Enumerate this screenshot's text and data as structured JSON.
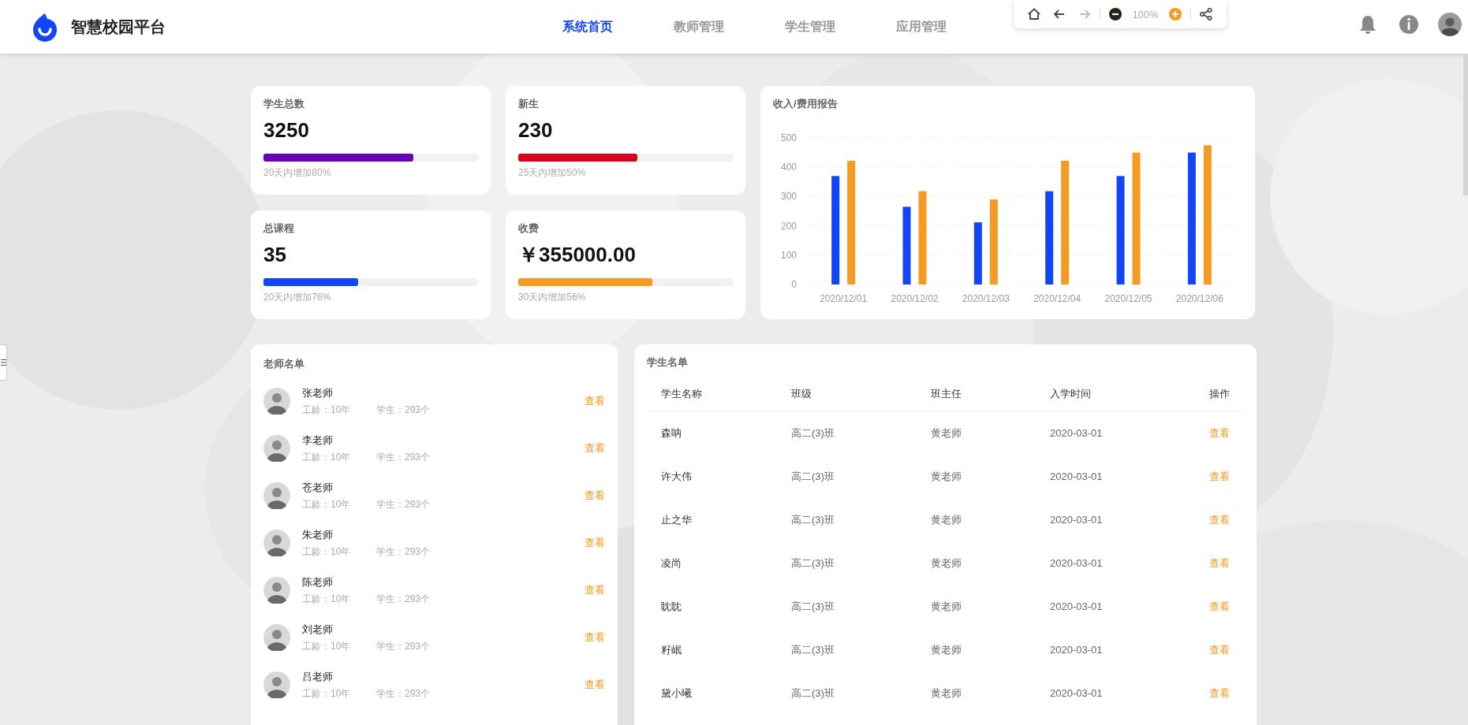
{
  "header": {
    "title": "智慧校园平台",
    "nav": [
      {
        "label": "系统首页",
        "selected": true
      },
      {
        "label": "教师管理",
        "selected": false
      },
      {
        "label": "学生管理",
        "selected": false
      },
      {
        "label": "应用管理",
        "selected": false
      }
    ],
    "toolbar": {
      "groups": [
        [
          {
            "kind": "home",
            "disabled": false
          },
          {
            "kind": "back",
            "disabled": false
          },
          {
            "kind": "forward",
            "disabled": true
          }
        ],
        [
          {
            "kind": "zoom-out",
            "disabled": false
          },
          {
            "kind": "zoom-level",
            "text": "100%"
          },
          {
            "kind": "zoom-in",
            "disabled": false
          }
        ],
        [
          {
            "kind": "share",
            "disabled": false
          }
        ]
      ]
    }
  },
  "stats": [
    {
      "label": "学生总数",
      "value": "3250",
      "level": 0.7,
      "color": "#6a00b8",
      "note": "20天内增加80%"
    },
    {
      "label": "新生",
      "value": "230",
      "level": 0.555,
      "color": "#d9001b",
      "note": "25天内增加50%"
    },
    {
      "label": "总课程",
      "value": "35",
      "level": 0.44,
      "color": "#1245f5",
      "note": "20天内增加76%"
    },
    {
      "label": "收费",
      "value": "￥355000.00",
      "level": 0.625,
      "color": "#f59a23",
      "note": "30天内增加56%"
    }
  ],
  "report": {
    "title": "收入/费用报告",
    "chart_data": {
      "type": "bar",
      "categories": [
        "2020/12/01",
        "2020/12/02",
        "2020/12/03",
        "2020/12/04",
        "2020/12/05",
        "2020/12/06"
      ],
      "series": [
        {
          "color": "#1245f5",
          "values": [
            370,
            265,
            212,
            318,
            370,
            450
          ]
        },
        {
          "color": "#f59a23",
          "values": [
            422,
            318,
            290,
            422,
            450,
            475
          ]
        }
      ],
      "grid": true,
      "ylim": [
        0,
        500
      ],
      "yticks": [
        0,
        100,
        200,
        300,
        400,
        500
      ]
    }
  },
  "teachers": {
    "title": "老师名单",
    "items": [
      {
        "name": "张老师",
        "experience": "工龄：10年",
        "students": "学生：293个",
        "action": "查看"
      },
      {
        "name": "李老师",
        "experience": "工龄：10年",
        "students": "学生：293个",
        "action": "查看"
      },
      {
        "name": "苍老师",
        "experience": "工龄：10年",
        "students": "学生：293个",
        "action": "查看"
      },
      {
        "name": "朱老师",
        "experience": "工龄：10年",
        "students": "学生：293个",
        "action": "查看"
      },
      {
        "name": "陈老师",
        "experience": "工龄：10年",
        "students": "学生：293个",
        "action": "查看"
      },
      {
        "name": "刘老师",
        "experience": "工龄：10年",
        "students": "学生：293个",
        "action": "查看"
      },
      {
        "name": "吕老师",
        "experience": "工龄：10年",
        "students": "学生：293个",
        "action": "查看"
      }
    ]
  },
  "students": {
    "title": "学生名单",
    "columns": [
      "学生名称",
      "班级",
      "班主任",
      "入学时间",
      "操作"
    ],
    "rows": [
      [
        "森呐",
        "高二(3)班",
        "黄老师",
        "2020-03-01",
        "查看"
      ],
      [
        "许大伟",
        "高二(3)班",
        "黄老师",
        "2020-03-01",
        "查看"
      ],
      [
        "止之华",
        "高二(3)班",
        "黄老师",
        "2020-03-01",
        "查看"
      ],
      [
        "凌尚",
        "高二(3)班",
        "黄老师",
        "2020-03-01",
        "查看"
      ],
      [
        "眈眈",
        "高二(3)班",
        "黄老师",
        "2020-03-01",
        "查看"
      ],
      [
        "籽岷",
        "高二(3)班",
        "黄老师",
        "2020-03-01",
        "查看"
      ],
      [
        "黛小曦",
        "高二(3)班",
        "黄老师",
        "2020-03-01",
        "查看"
      ]
    ]
  }
}
